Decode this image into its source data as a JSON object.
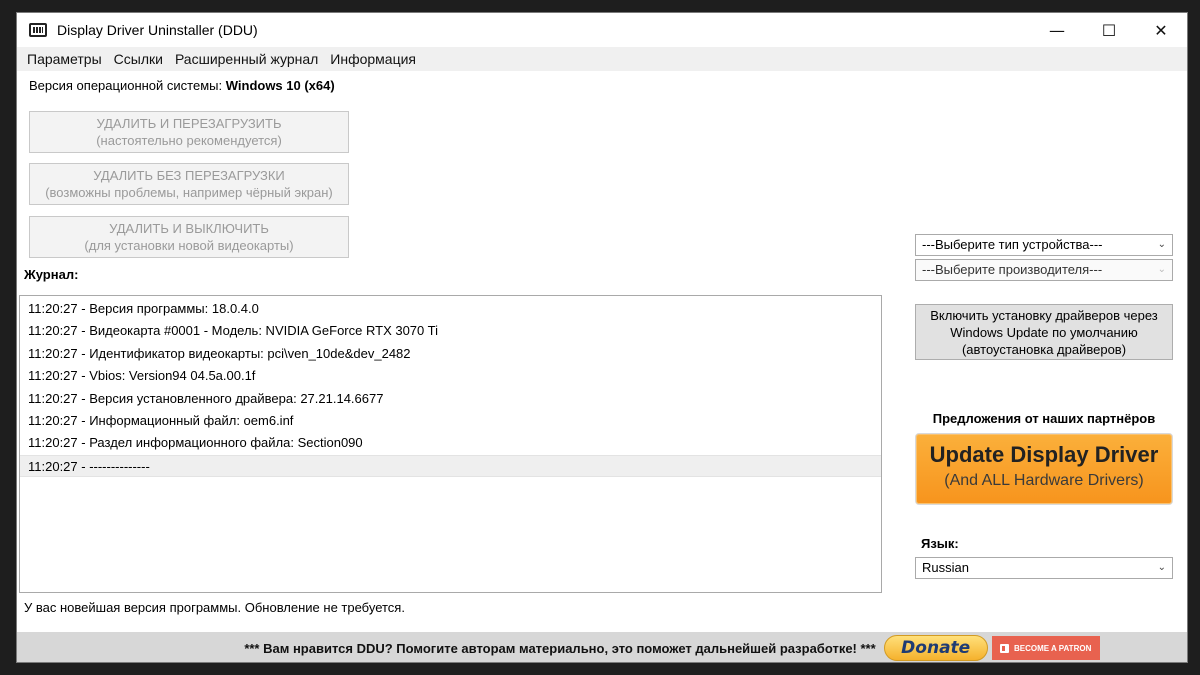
{
  "window": {
    "title": "Display Driver Uninstaller (DDU)",
    "controls": {
      "minimize": "—",
      "maximize": "☐",
      "close": "✕"
    }
  },
  "menu": [
    "Параметры",
    "Ссылки",
    "Расширенный журнал",
    "Информация"
  ],
  "os": {
    "label": "Версия операционной системы:",
    "value": "Windows 10 (x64)"
  },
  "actions": [
    {
      "title": "УДАЛИТЬ И ПЕРЕЗАГРУЗИТЬ",
      "subtitle": "(настоятельно рекомендуется)"
    },
    {
      "title": "УДАЛИТЬ БЕЗ ПЕРЕЗАГРУЗКИ",
      "subtitle": "(возможны проблемы, например чёрный экран)"
    },
    {
      "title": "УДАЛИТЬ И ВЫКЛЮЧИТЬ",
      "subtitle": "(для установки новой видеокарты)"
    }
  ],
  "journal": {
    "label": "Журнал:",
    "entries": [
      "11:20:27 - Версия программы: 18.0.4.0",
      "11:20:27 - Видеокарта #0001 - Модель: NVIDIA GeForce RTX 3070 Ti",
      "11:20:27 - Идентификатор видеокарты: pci\\ven_10de&dev_2482",
      "11:20:27 - Vbios: Version94 04.5a.00.1f",
      "11:20:27 - Версия установленного драйвера: 27.21.14.6677",
      "11:20:27 - Информационный файл: oem6.inf",
      "11:20:27 - Раздел информационного файла: Section090",
      "11:20:27 - --------------"
    ]
  },
  "status": "У вас новейшая версия программы. Обновление не требуется.",
  "device_type": {
    "value": "---Выберите тип устройства---"
  },
  "vendor": {
    "value": "---Выберите производителя---"
  },
  "windows_update_button": {
    "line1": "Включить установку драйверов через",
    "line2": "Windows Update по умолчанию",
    "line3": "(автоустановка драйверов)"
  },
  "partners": {
    "label": "Предложения от наших партнёров",
    "ad_title": "Update Display Driver",
    "ad_subtitle": "(And ALL Hardware Drivers)"
  },
  "language": {
    "label": "Язык:",
    "value": "Russian"
  },
  "footer": {
    "text": "*** Вам нравится DDU? Помогите авторам материально, это поможет дальнейшей разработке! ***",
    "donate": "Donate",
    "patron": "BECOME A PATRON"
  },
  "colors": {
    "ad_orange": "#f7941d",
    "patron_red": "#e8624f",
    "donate_yellow": "#f5b12d"
  }
}
